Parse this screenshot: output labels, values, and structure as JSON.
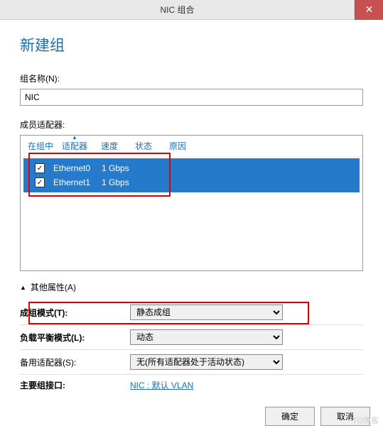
{
  "titlebar": {
    "title": "NIC 组合",
    "close_glyph": "✕"
  },
  "page": {
    "title": "新建组"
  },
  "teamname": {
    "label": "组名称(N):",
    "value": "NIC"
  },
  "adapters": {
    "label": "成员适配器:",
    "headers": {
      "ingroup": "在组中",
      "adapter": "适配器",
      "speed": "速度",
      "state": "状态",
      "reason": "原因"
    },
    "rows": [
      {
        "checked": "✓",
        "name": "Ethernet0",
        "speed": "1 Gbps"
      },
      {
        "checked": "✓",
        "name": "Ethernet1",
        "speed": "1 Gbps"
      }
    ]
  },
  "collapse": {
    "arrow": "▲",
    "label": "其他属性(A)"
  },
  "props": {
    "mode": {
      "label": "成组模式(T):",
      "value": "静态成组"
    },
    "balance": {
      "label": "负载平衡模式(L):",
      "value": "动态"
    },
    "standby": {
      "label": "备用适配器(S):",
      "value": "无(所有适配器处于活动状态)"
    },
    "primary": {
      "label": "主要组接口:",
      "value": "NIC : 默认 VLAN"
    }
  },
  "buttons": {
    "ok": "确定",
    "cancel": "取消"
  },
  "watermark": "TO博客"
}
